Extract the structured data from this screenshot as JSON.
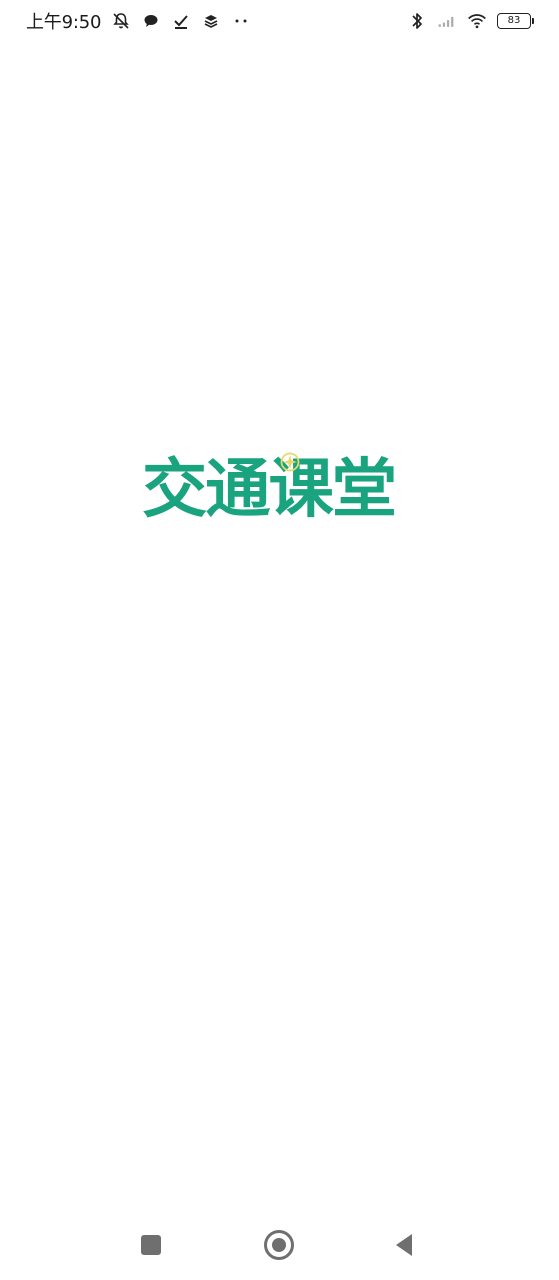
{
  "status_bar": {
    "time": "上午9:50",
    "battery": "83",
    "icons_left": [
      "muted-bell-icon",
      "chat-bubble-icon",
      "check-icon",
      "layers-icon",
      "more-dots-icon"
    ],
    "icons_right": [
      "bluetooth-icon",
      "signal-icon",
      "wifi-icon",
      "battery-icon"
    ]
  },
  "splash": {
    "logo_text": "交通课堂",
    "logo_color": "#1aa37f",
    "spark_color": "#e7d86a"
  },
  "nav_bar": {
    "buttons": [
      "recents",
      "home",
      "back"
    ]
  }
}
